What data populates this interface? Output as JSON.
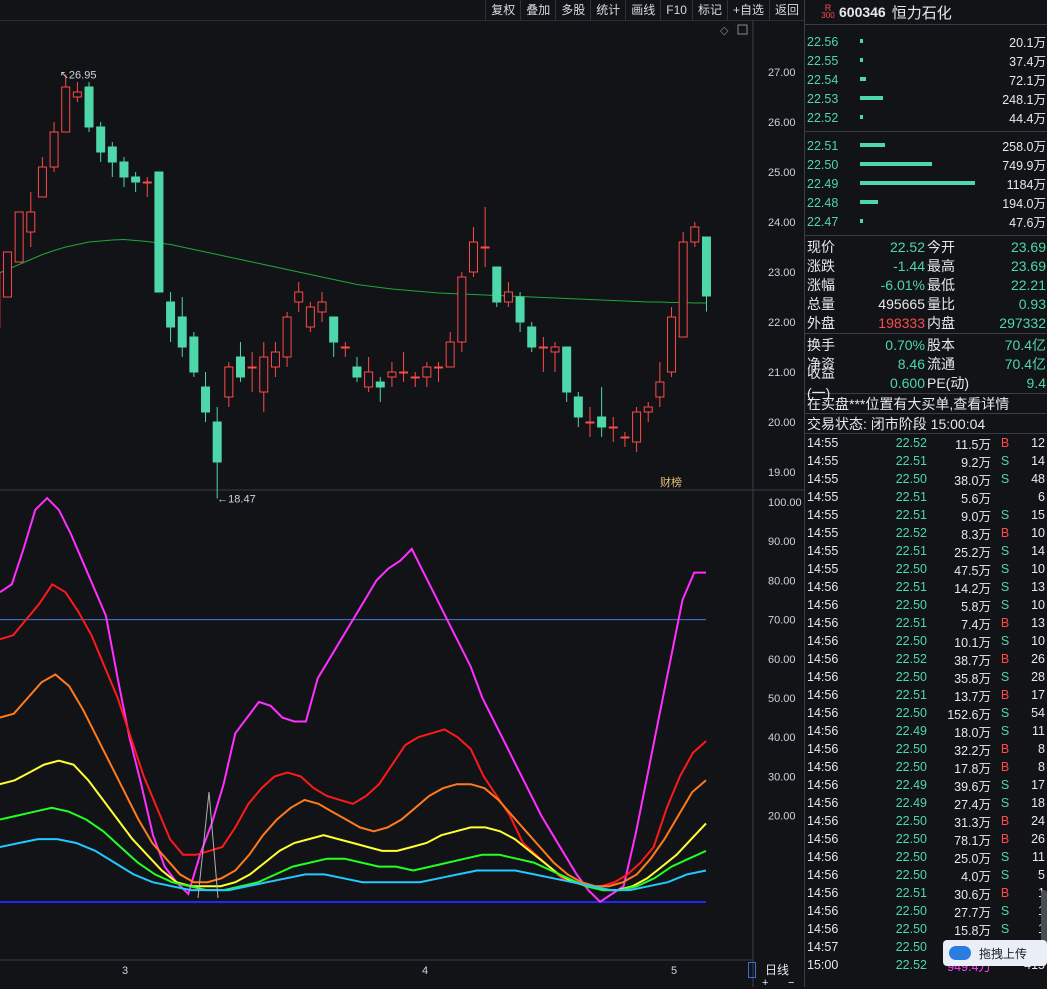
{
  "toolbar": {
    "buttons": [
      "复权",
      "叠加",
      "多股",
      "统计",
      "画线",
      "F10",
      "标记",
      "+自选",
      "返回"
    ]
  },
  "stock": {
    "badge_top": "R",
    "badge_bottom": "300",
    "code": "600346",
    "name": "恒力石化"
  },
  "asks": [
    {
      "price": "22.56",
      "vol": "20.1万",
      "ratio": 0.01
    },
    {
      "price": "22.55",
      "vol": "37.4万",
      "ratio": 0.02
    },
    {
      "price": "22.54",
      "vol": "72.1万",
      "ratio": 0.05
    },
    {
      "price": "22.53",
      "vol": "248.1万",
      "ratio": 0.2
    },
    {
      "price": "22.52",
      "vol": "44.4万",
      "ratio": 0.03
    }
  ],
  "bids": [
    {
      "price": "22.51",
      "vol": "258.0万",
      "ratio": 0.22
    },
    {
      "price": "22.50",
      "vol": "749.9万",
      "ratio": 0.63
    },
    {
      "price": "22.49",
      "vol": "1184万",
      "ratio": 1.0
    },
    {
      "price": "22.48",
      "vol": "194.0万",
      "ratio": 0.16
    },
    {
      "price": "22.47",
      "vol": "47.6万",
      "ratio": 0.03
    }
  ],
  "quote": [
    {
      "l1": "现价",
      "v1": "22.52",
      "c1": "green",
      "l2": "今开",
      "v2": "23.69",
      "c2": "green"
    },
    {
      "l1": "涨跌",
      "v1": "-1.44",
      "c1": "green",
      "l2": "最高",
      "v2": "23.69",
      "c2": "green"
    },
    {
      "l1": "涨幅",
      "v1": "-6.01%",
      "c1": "green",
      "l2": "最低",
      "v2": "22.21",
      "c2": "green"
    },
    {
      "l1": "总量",
      "v1": "495665",
      "c1": "white",
      "l2": "量比",
      "v2": "0.93",
      "c2": "green"
    },
    {
      "l1": "外盘",
      "v1": "198333",
      "c1": "red",
      "l2": "内盘",
      "v2": "297332",
      "c2": "green"
    }
  ],
  "fundamentals": [
    {
      "l1": "换手",
      "v1": "0.70%",
      "l2": "股本",
      "v2": "70.4亿"
    },
    {
      "l1": "净资",
      "v1": "8.46",
      "l2": "流通",
      "v2": "70.4亿"
    },
    {
      "l1": "收益(一)",
      "v1": "0.600",
      "l2": "PE(动)",
      "v2": "9.4"
    }
  ],
  "notice": "在买盘***位置有大买单,查看详情",
  "status": "交易状态: 闭市阶段 15:00:04",
  "ticks": [
    [
      "14:55",
      "22.52",
      "11.5万",
      "B",
      "12"
    ],
    [
      "14:55",
      "22.51",
      "9.2万",
      "S",
      "14"
    ],
    [
      "14:55",
      "22.50",
      "38.0万",
      "S",
      "48"
    ],
    [
      "14:55",
      "22.51",
      "5.6万",
      "",
      "6"
    ],
    [
      "14:55",
      "22.51",
      "9.0万",
      "S",
      "15"
    ],
    [
      "14:55",
      "22.52",
      "8.3万",
      "B",
      "10"
    ],
    [
      "14:55",
      "22.51",
      "25.2万",
      "S",
      "14"
    ],
    [
      "14:55",
      "22.50",
      "47.5万",
      "S",
      "10"
    ],
    [
      "14:56",
      "22.51",
      "14.2万",
      "S",
      "13"
    ],
    [
      "14:56",
      "22.50",
      "5.8万",
      "S",
      "10"
    ],
    [
      "14:56",
      "22.51",
      "7.4万",
      "B",
      "13"
    ],
    [
      "14:56",
      "22.50",
      "10.1万",
      "S",
      "10"
    ],
    [
      "14:56",
      "22.52",
      "38.7万",
      "B",
      "26"
    ],
    [
      "14:56",
      "22.50",
      "35.8万",
      "S",
      "28"
    ],
    [
      "14:56",
      "22.51",
      "13.7万",
      "B",
      "17"
    ],
    [
      "14:56",
      "22.50",
      "152.6万",
      "S",
      "54"
    ],
    [
      "14:56",
      "22.49",
      "18.0万",
      "S",
      "11"
    ],
    [
      "14:56",
      "22.50",
      "32.2万",
      "B",
      "8"
    ],
    [
      "14:56",
      "22.50",
      "17.8万",
      "B",
      "8"
    ],
    [
      "14:56",
      "22.49",
      "39.6万",
      "S",
      "17"
    ],
    [
      "14:56",
      "22.49",
      "27.4万",
      "S",
      "18"
    ],
    [
      "14:56",
      "22.50",
      "31.3万",
      "B",
      "24"
    ],
    [
      "14:56",
      "22.50",
      "78.1万",
      "B",
      "26"
    ],
    [
      "14:56",
      "22.50",
      "25.0万",
      "S",
      "11"
    ],
    [
      "14:56",
      "22.50",
      "4.0万",
      "S",
      "5"
    ],
    [
      "14:56",
      "22.51",
      "30.6万",
      "B",
      "1"
    ],
    [
      "14:56",
      "22.50",
      "27.7万",
      "S",
      "1"
    ],
    [
      "14:56",
      "22.50",
      "15.8万",
      "S",
      "1"
    ],
    [
      "14:57",
      "22.50",
      "",
      "",
      ""
    ],
    [
      "15:00",
      "22.52",
      "949.4万",
      "",
      "415"
    ]
  ],
  "upload_button": "拖拽上传",
  "bottom_tab": "日线",
  "chart_data": [
    {
      "type": "candlestick",
      "price_axis": [
        "27.00",
        "26.00",
        "25.00",
        "24.00",
        "23.00",
        "22.00",
        "21.00",
        "20.00",
        "19.00"
      ],
      "ylim": [
        18.5,
        27.6
      ],
      "high_label": "26.95",
      "low_label": "18.47",
      "badge": "财榜",
      "candles": [
        [
          21.9,
          23.0,
          22.5,
          23.3
        ],
        [
          22.5,
          23.4,
          23.2,
          23.4
        ],
        [
          23.2,
          24.2,
          23.6,
          23.9
        ],
        [
          23.8,
          24.2,
          23.5,
          24.6
        ],
        [
          24.5,
          25.1,
          24.5,
          25.3
        ],
        [
          25.1,
          25.8,
          25.0,
          26.0
        ],
        [
          25.8,
          26.7,
          25.8,
          26.95
        ],
        [
          26.5,
          26.6,
          26.4,
          26.8
        ],
        [
          26.7,
          25.9,
          25.8,
          26.8
        ],
        [
          25.9,
          25.4,
          25.2,
          26.0
        ],
        [
          25.5,
          25.2,
          24.9,
          25.6
        ],
        [
          25.2,
          24.9,
          24.7,
          25.3
        ],
        [
          24.9,
          24.8,
          24.6,
          25.0
        ],
        [
          24.8,
          24.8,
          24.5,
          24.9
        ],
        [
          25.0,
          22.6,
          22.6,
          25.0
        ],
        [
          22.4,
          21.9,
          21.6,
          22.6
        ],
        [
          22.1,
          21.5,
          21.3,
          22.5
        ],
        [
          21.7,
          21.0,
          20.9,
          21.8
        ],
        [
          20.7,
          20.2,
          20.0,
          21.0
        ],
        [
          20.0,
          19.2,
          18.47,
          20.3
        ],
        [
          20.5,
          21.1,
          20.3,
          21.2
        ],
        [
          21.3,
          20.9,
          20.8,
          21.6
        ],
        [
          21.1,
          21.1,
          20.6,
          21.4
        ],
        [
          20.6,
          21.3,
          20.2,
          21.6
        ],
        [
          21.1,
          21.4,
          20.9,
          21.6
        ],
        [
          21.3,
          22.1,
          21.1,
          22.2
        ],
        [
          22.4,
          22.6,
          22.2,
          22.8
        ],
        [
          21.9,
          22.3,
          21.8,
          22.4
        ],
        [
          22.2,
          22.4,
          22.0,
          22.6
        ],
        [
          22.1,
          21.6,
          21.3,
          22.1
        ],
        [
          21.5,
          21.5,
          21.3,
          21.6
        ],
        [
          21.1,
          20.9,
          20.8,
          21.3
        ],
        [
          20.7,
          21.0,
          20.6,
          21.3
        ],
        [
          20.8,
          20.7,
          20.4,
          20.9
        ],
        [
          20.9,
          21.0,
          20.7,
          21.2
        ],
        [
          21.0,
          21.0,
          20.8,
          21.4
        ],
        [
          20.9,
          20.9,
          20.7,
          21.0
        ],
        [
          20.9,
          21.1,
          20.7,
          21.2
        ],
        [
          21.1,
          21.1,
          20.8,
          21.2
        ],
        [
          21.1,
          21.6,
          21.1,
          21.8
        ],
        [
          21.6,
          22.9,
          21.4,
          23.0
        ],
        [
          23.0,
          23.6,
          22.9,
          23.9
        ],
        [
          23.5,
          23.5,
          23.1,
          24.3
        ],
        [
          23.1,
          22.4,
          22.3,
          23.1
        ],
        [
          22.4,
          22.6,
          22.3,
          22.8
        ],
        [
          22.5,
          22.0,
          21.8,
          22.6
        ],
        [
          21.9,
          21.5,
          21.4,
          22.0
        ],
        [
          21.5,
          21.5,
          21.0,
          21.7
        ],
        [
          21.4,
          21.5,
          21.0,
          21.6
        ],
        [
          21.5,
          20.6,
          20.4,
          21.5
        ],
        [
          20.5,
          20.1,
          19.9,
          20.6
        ],
        [
          20.0,
          20.0,
          19.7,
          20.3
        ],
        [
          20.1,
          19.9,
          19.7,
          20.7
        ],
        [
          19.9,
          19.9,
          19.6,
          20.1
        ],
        [
          19.7,
          19.7,
          19.5,
          19.8
        ],
        [
          19.6,
          20.2,
          19.4,
          20.3
        ],
        [
          20.2,
          20.3,
          20.0,
          20.4
        ],
        [
          20.5,
          20.8,
          20.3,
          21.2
        ],
        [
          21.0,
          22.1,
          20.9,
          22.3
        ],
        [
          21.7,
          23.6,
          21.7,
          23.8
        ],
        [
          23.6,
          23.9,
          23.5,
          24.0
        ],
        [
          23.7,
          22.52,
          22.21,
          23.69
        ]
      ],
      "ma": [
        22.95,
        23.05,
        23.15,
        23.25,
        23.35,
        23.43,
        23.5,
        23.55,
        23.6,
        23.62,
        23.64,
        23.65,
        23.63,
        23.61,
        23.58,
        23.55,
        23.5,
        23.45,
        23.4,
        23.35,
        23.3,
        23.25,
        23.2,
        23.15,
        23.1,
        23.05,
        23.0,
        22.95,
        22.9,
        22.85,
        22.8,
        22.75,
        22.72,
        22.69,
        22.66,
        22.64,
        22.62,
        22.6,
        22.58,
        22.57,
        22.56,
        22.55,
        22.54,
        22.53,
        22.52,
        22.51,
        22.5,
        22.49,
        22.48,
        22.47,
        22.46,
        22.45,
        22.44,
        22.43,
        22.42,
        22.41,
        22.4,
        22.4,
        22.39,
        22.39,
        22.38,
        22.38
      ]
    },
    {
      "type": "line",
      "axis": [
        "100.00",
        "90.00",
        "80.00",
        "70.00",
        "60.00",
        "50.00",
        "40.00",
        "30.00",
        "20.00"
      ],
      "ylim": [
        0,
        105
      ],
      "hline_blue_light": 70,
      "hline_blue": 0,
      "x_labels": [
        "3",
        "4",
        "5"
      ],
      "series": [
        {
          "color": "#ff2fff",
          "values": [
            77,
            79,
            88,
            98,
            101,
            98,
            92,
            85,
            78,
            71,
            55,
            40,
            28,
            15,
            7,
            3,
            0,
            10,
            18,
            28,
            41,
            45,
            49,
            48,
            45,
            44,
            44,
            55,
            60,
            65,
            70,
            75,
            80,
            83,
            85,
            88,
            82,
            76,
            70,
            64,
            58,
            50,
            44,
            38,
            32,
            26,
            20,
            15,
            10,
            5,
            1,
            -2,
            0,
            2,
            15,
            30,
            45,
            60,
            75,
            82,
            82
          ]
        },
        {
          "color": "#ff1a1a",
          "values": [
            65,
            66,
            70,
            74,
            79,
            77,
            72,
            66,
            58,
            50,
            40,
            30,
            22,
            14,
            10,
            10,
            11,
            12,
            17,
            23,
            27,
            30,
            31,
            30,
            27,
            25,
            24,
            23,
            25,
            28,
            33,
            38,
            40,
            41,
            42,
            40,
            37,
            30,
            25,
            20,
            13,
            10,
            7,
            4,
            3,
            2,
            2,
            3,
            5,
            8,
            12,
            22,
            30,
            36,
            39
          ]
        },
        {
          "color": "#ff7a1a",
          "values": [
            45,
            46,
            50,
            54,
            56,
            53,
            47,
            40,
            33,
            26,
            19,
            13,
            9,
            5,
            3,
            3,
            4,
            6,
            10,
            15,
            19,
            22,
            24,
            23,
            21,
            19,
            17,
            16,
            17,
            19,
            22,
            25,
            27,
            28,
            28,
            27,
            24,
            20,
            16,
            12,
            8,
            5,
            3,
            2,
            2,
            3,
            5,
            9,
            14,
            20,
            26,
            29
          ]
        },
        {
          "color": "#ffff33",
          "values": [
            28,
            29,
            31,
            33,
            34,
            33,
            29,
            24,
            19,
            14,
            10,
            6,
            3,
            2,
            2,
            2,
            3,
            5,
            8,
            11,
            13,
            14,
            15,
            14,
            13,
            12,
            11,
            11,
            12,
            13,
            15,
            16,
            17,
            17,
            16,
            14,
            11,
            8,
            5,
            3,
            2,
            1,
            1,
            2,
            4,
            7,
            10,
            14,
            18
          ]
        },
        {
          "color": "#22ff22",
          "values": [
            19,
            20,
            21,
            22,
            21,
            19,
            16,
            12,
            8,
            5,
            3,
            2,
            1,
            1,
            2,
            3,
            5,
            7,
            8,
            9,
            9,
            8,
            7,
            7,
            6,
            7,
            8,
            9,
            10,
            10,
            9,
            8,
            6,
            4,
            2,
            1,
            1,
            2,
            4,
            7,
            9,
            11
          ]
        },
        {
          "color": "#22c8ff",
          "values": [
            12,
            13,
            14,
            14,
            13,
            11,
            8,
            5,
            3,
            2,
            1,
            1,
            1,
            2,
            3,
            4,
            5,
            5,
            4,
            3,
            3,
            3,
            3,
            4,
            5,
            6,
            6,
            6,
            5,
            4,
            3,
            2,
            1,
            1,
            2,
            3,
            5,
            6
          ]
        },
        {
          "color": "#b0b0b0",
          "values": [
            0,
            30,
            0
          ]
        }
      ]
    }
  ]
}
